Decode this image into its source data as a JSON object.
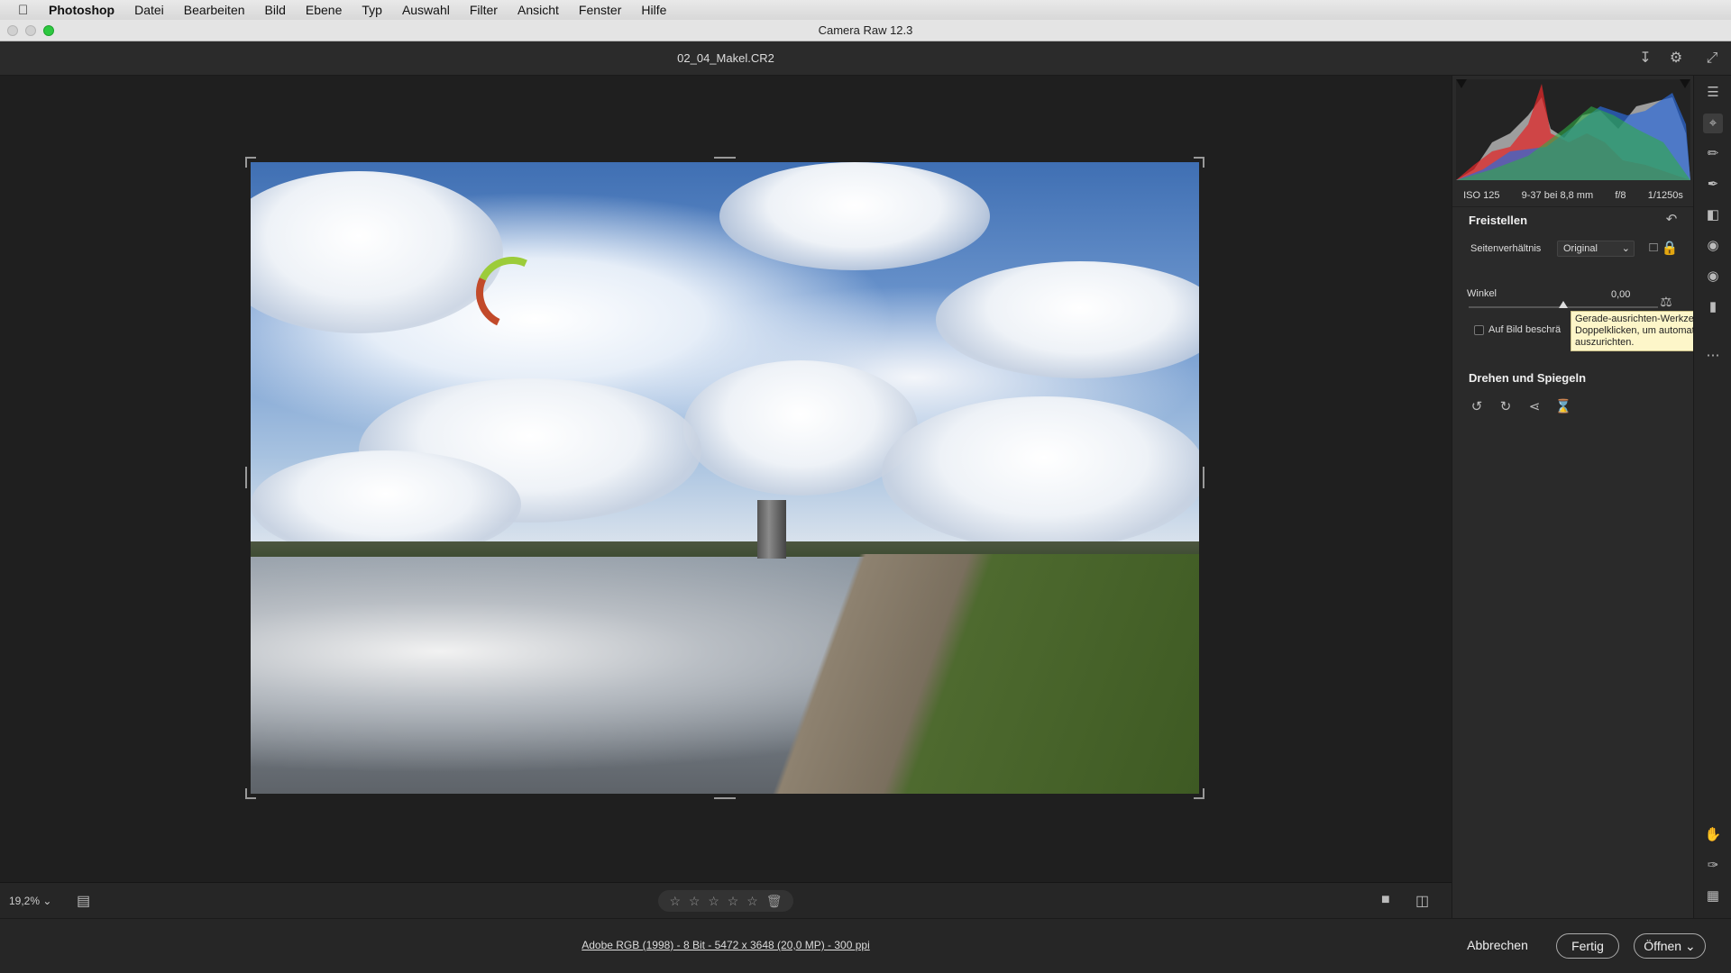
{
  "menubar": {
    "app": "Photoshop",
    "items": [
      "Datei",
      "Bearbeiten",
      "Bild",
      "Ebene",
      "Typ",
      "Auswahl",
      "Filter",
      "Ansicht",
      "Fenster",
      "Hilfe"
    ]
  },
  "window": {
    "title": "Camera Raw 12.3"
  },
  "document": {
    "filename": "02_04_Makel.CR2"
  },
  "exif": {
    "iso": "ISO 125",
    "lens": "9-37 bei 8,8 mm",
    "aperture": "f/8",
    "shutter": "1/1250s"
  },
  "crop_panel": {
    "title": "Freistellen",
    "aspect_label": "Seitenverhältnis",
    "aspect_value": "Original",
    "angle_label": "Winkel",
    "angle_value": "0,00",
    "angle_fraction": 0.5,
    "constrain_label": "Auf Bild beschrä",
    "tooltip_line1": "Gerade-ausrichten-Werkzeug (A).",
    "tooltip_line2": "Doppelklicken, um automatisch ge",
    "tooltip_line3": "auszurichten."
  },
  "rotate_panel": {
    "title": "Drehen und Spiegeln"
  },
  "bottombar": {
    "zoom": "19,2%"
  },
  "footer": {
    "info": "Adobe RGB (1998) - 8 Bit - 5472 x 3648 (20,0 MP) - 300 ppi",
    "cancel": "Abbrechen",
    "done": "Fertig",
    "open": "Öffnen"
  },
  "colors": {
    "accent": "#9ccc3a",
    "tooltip_bg": "#fdf6c9"
  }
}
